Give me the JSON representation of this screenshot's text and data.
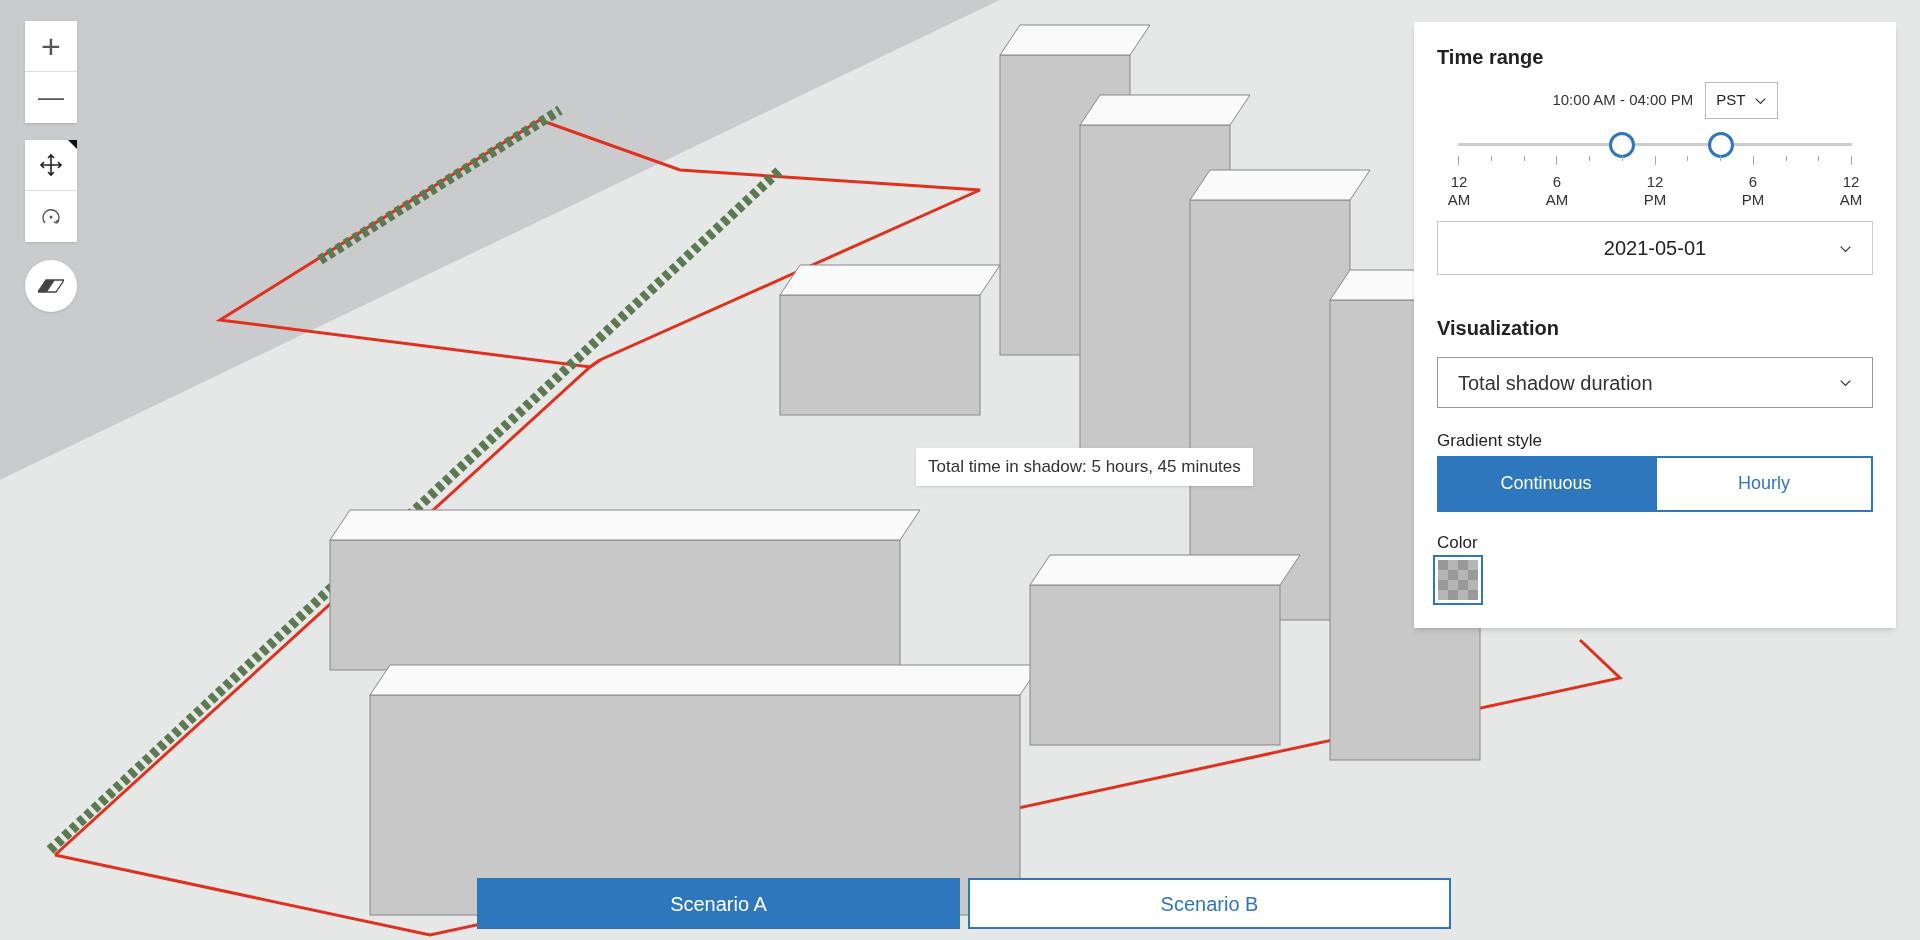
{
  "map_controls": {
    "zoom_in": "+",
    "zoom_out": "—"
  },
  "tooltip": "Total time in shadow: 5 hours, 45 minutes",
  "panel": {
    "time_range": {
      "title": "Time range",
      "range_label": "10:00 AM - 04:00 PM",
      "timezone": "PST",
      "slider": {
        "thumbs": [
          {
            "level": 0.4167
          },
          {
            "level": 0.6667
          }
        ],
        "ticks": [
          {
            "kind": "major"
          },
          {
            "kind": "minor"
          },
          {
            "kind": "minor"
          },
          {
            "kind": "major"
          },
          {
            "kind": "minor"
          },
          {
            "kind": "minor"
          },
          {
            "kind": "major"
          },
          {
            "kind": "minor"
          },
          {
            "kind": "minor"
          },
          {
            "kind": "major"
          },
          {
            "kind": "minor"
          },
          {
            "kind": "minor"
          },
          {
            "kind": "major"
          }
        ],
        "labels": [
          [
            "12",
            "AM"
          ],
          [
            "6",
            "AM"
          ],
          [
            "12",
            "PM"
          ],
          [
            "6",
            "PM"
          ],
          [
            "12",
            "AM"
          ]
        ]
      },
      "date": "2021-05-01"
    },
    "visualization": {
      "title": "Visualization",
      "mode": "Total shadow duration",
      "gradient_label": "Gradient style",
      "gradient_options": [
        {
          "label": "Continuous",
          "selected": true
        },
        {
          "label": "Hourly",
          "selected": false
        }
      ],
      "color_label": "Color"
    }
  },
  "scenarios": [
    {
      "label": "Scenario A",
      "selected": true
    },
    {
      "label": "Scenario B",
      "selected": false
    }
  ]
}
